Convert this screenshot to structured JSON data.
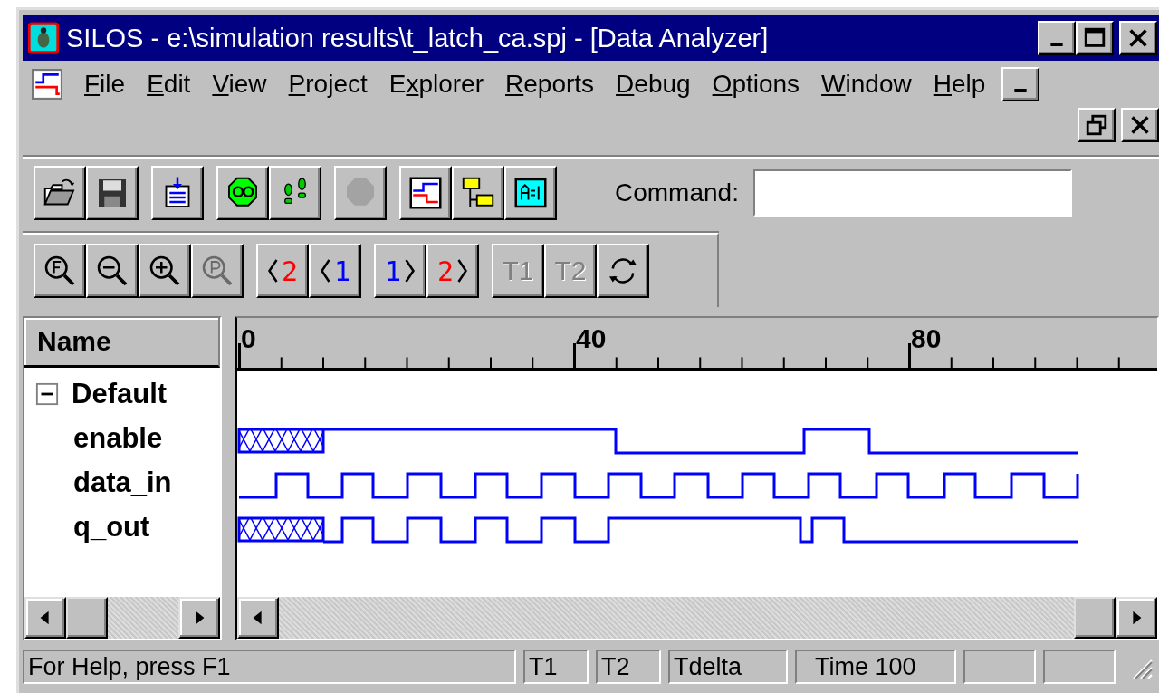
{
  "window": {
    "title": "SILOS - e:\\simulation results\\t_latch_ca.spj - [Data Analyzer]"
  },
  "menu": [
    {
      "key": "F",
      "post": "ile"
    },
    {
      "key": "E",
      "post": "dit"
    },
    {
      "key": "V",
      "post": "iew"
    },
    {
      "key": "P",
      "post": "roject"
    },
    {
      "pre": "E",
      "key": "x",
      "post": "plorer"
    },
    {
      "key": "R",
      "post": "eports"
    },
    {
      "key": "D",
      "post": "ebug"
    },
    {
      "key": "O",
      "post": "ptions"
    },
    {
      "key": "W",
      "post": "indow"
    },
    {
      "key": "H",
      "post": "elp"
    }
  ],
  "toolbars": [
    [
      [
        {
          "kind": "icon",
          "disabled": false
        },
        {
          "kind": "icon",
          "disabled": false
        }
      ],
      [
        {
          "kind": "icon",
          "disabled": false
        }
      ],
      [
        {
          "kind": "icon",
          "disabled": false
        },
        {
          "kind": "icon",
          "disabled": false
        }
      ],
      [
        {
          "kind": "icon",
          "disabled": true
        }
      ],
      [
        {
          "kind": "icon",
          "disabled": false
        },
        {
          "kind": "icon",
          "disabled": false
        },
        {
          "kind": "icon",
          "disabled": false
        }
      ]
    ],
    [
      [
        {
          "kind": "icon",
          "disabled": false
        },
        {
          "kind": "icon",
          "disabled": false
        },
        {
          "kind": "icon",
          "disabled": false
        },
        {
          "kind": "icon",
          "disabled": true
        }
      ],
      [
        {
          "kind": "prev",
          "label": "2",
          "color": "#ff0000",
          "disabled": false
        },
        {
          "kind": "prev",
          "label": "1",
          "color": "#0000ff",
          "disabled": false
        }
      ],
      [
        {
          "kind": "next",
          "label": "1",
          "color": "#0000ff",
          "disabled": false
        },
        {
          "kind": "next",
          "label": "2",
          "color": "#ff0000",
          "disabled": false
        }
      ],
      [
        {
          "kind": "text",
          "label": "T1",
          "disabled": true
        },
        {
          "kind": "text",
          "label": "T2",
          "disabled": true
        },
        {
          "kind": "icon",
          "disabled": false
        }
      ]
    ]
  ],
  "command": {
    "label": "Command:"
  },
  "names": {
    "header": "Name",
    "group": {
      "label": "Default",
      "expanded": true,
      "children": [
        {
          "label": "enable"
        },
        {
          "label": "data_in"
        },
        {
          "label": "q_out"
        }
      ]
    }
  },
  "ruler": [
    "0",
    "40",
    "80"
  ],
  "status_bar": [
    "For Help, press F1",
    "T1",
    "T2",
    "Tdelta",
    "Time 100"
  ]
}
